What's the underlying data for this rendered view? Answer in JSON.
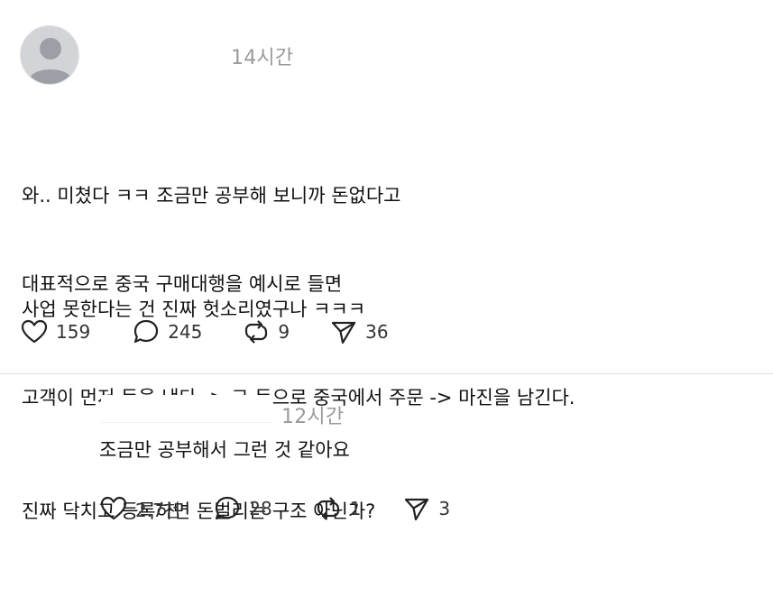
{
  "post": {
    "time": "14시간",
    "lines1": [
      "와.. 미쳤다 ㅋㅋ 조금만 공부해 보니까 돈없다고",
      "사업 못한다는 건 진짜 헛소리였구나 ㅋㅋㅋ"
    ],
    "lines2": [
      "대표적으로 중국 구매대행을 예시로 들면",
      "고객이 먼저 돈을 낸다 -> 그 돈으로 중국에서 주문 -> 마진을 남긴다.",
      "진짜 닥치고 등록하면 돈벌리는 구조 아닌가?"
    ],
    "stats": {
      "likes": "159",
      "comments": "245",
      "reposts": "9",
      "shares": "36"
    }
  },
  "reply": {
    "time": "12시간",
    "text": "조금만 공부해서 그런 것 같아요",
    "stats": {
      "likes": "2.7천",
      "comments": "28",
      "reposts": "1",
      "shares": "3"
    }
  },
  "icons": {
    "like": "heart-icon",
    "comment": "speech-bubble-icon",
    "repost": "repost-icon",
    "share": "send-icon"
  },
  "colors": {
    "text": "#111111",
    "muted": "#9a9a9a",
    "divider": "#dddddd",
    "avatar_bg": "#d3d4d8",
    "avatar_fg": "#9d9fa6"
  }
}
